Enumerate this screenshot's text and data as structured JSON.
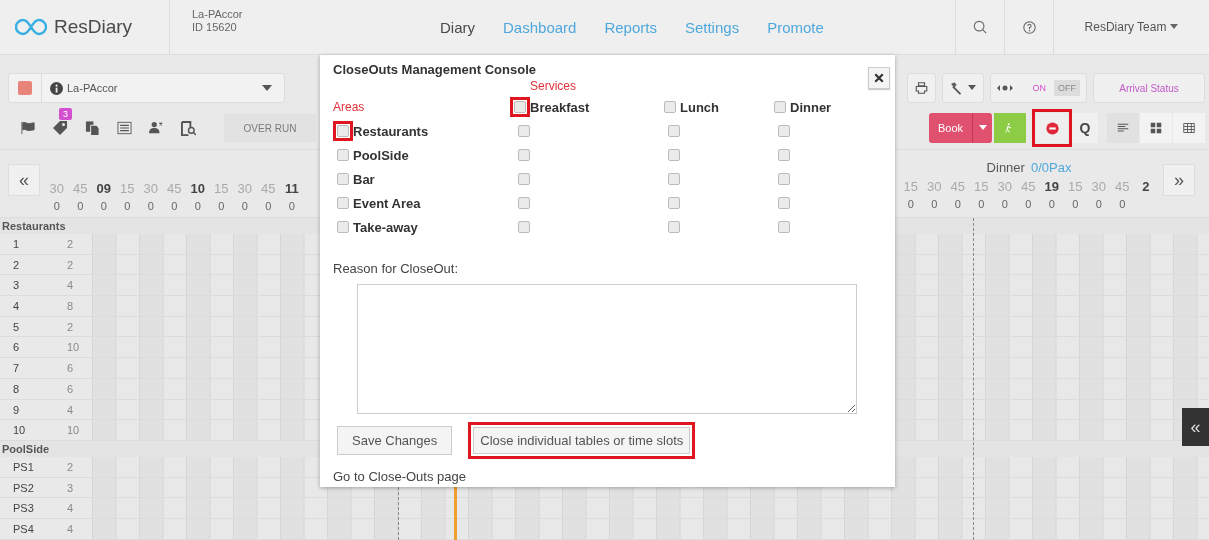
{
  "header": {
    "logo": "ResDiary",
    "venue": {
      "name": "La-PAccor",
      "id": "ID 15620"
    },
    "nav": [
      {
        "label": "Diary",
        "selected": true
      },
      {
        "label": "Dashboard",
        "selected": false
      },
      {
        "label": "Reports",
        "selected": false
      },
      {
        "label": "Settings",
        "selected": false
      },
      {
        "label": "Promote",
        "selected": false
      }
    ],
    "user": "ResDiary Team"
  },
  "toolbar": {
    "venue_select": "La-PAccor",
    "tag_badge": "3",
    "over_run": "OVER RUN",
    "toggle": [
      {
        "label": "ON",
        "selected": false
      },
      {
        "label": "OFF",
        "selected": true
      }
    ],
    "arrival_status": "Arrival Status",
    "book": "Book",
    "block_highlighted": true,
    "queue": "Q",
    "views": [
      {
        "kind": "list",
        "selected": true
      },
      {
        "kind": "tiles",
        "selected": false
      },
      {
        "kind": "table",
        "selected": false
      }
    ]
  },
  "timeline": {
    "prev": "«",
    "next": "»",
    "left_ticks": [
      {
        "label": "30",
        "hour": false
      },
      {
        "label": "45",
        "hour": false
      },
      {
        "label": "09",
        "hour": true
      },
      {
        "label": "15",
        "hour": false
      },
      {
        "label": "30",
        "hour": false
      },
      {
        "label": "45",
        "hour": false
      },
      {
        "label": "10",
        "hour": true
      },
      {
        "label": "15",
        "hour": false
      },
      {
        "label": "30",
        "hour": false
      },
      {
        "label": "45",
        "hour": false
      },
      {
        "label": "11",
        "hour": true
      }
    ],
    "left_counts": [
      "0",
      "0",
      "0",
      "0",
      "0",
      "0",
      "0",
      "0",
      "0",
      "0",
      "0"
    ],
    "service": "Dinner",
    "pax": "0/0Pax",
    "right_ticks": [
      {
        "label": "15",
        "hour": false
      },
      {
        "label": "30",
        "hour": false
      },
      {
        "label": "45",
        "hour": false
      },
      {
        "label": "15",
        "hour": false
      },
      {
        "label": "30",
        "hour": false
      },
      {
        "label": "45",
        "hour": false
      },
      {
        "label": "19",
        "hour": true
      },
      {
        "label": "15",
        "hour": false
      },
      {
        "label": "30",
        "hour": false
      },
      {
        "label": "45",
        "hour": false
      },
      {
        "label": "2",
        "hour": true
      }
    ],
    "right_counts": [
      "0",
      "0",
      "0",
      "0",
      "0",
      "0",
      "0",
      "0",
      "0",
      "0"
    ]
  },
  "sections": [
    {
      "name": "Restaurants",
      "tables": [
        {
          "name": "1",
          "covers": "2"
        },
        {
          "name": "2",
          "covers": "2"
        },
        {
          "name": "3",
          "covers": "4"
        },
        {
          "name": "4",
          "covers": "8"
        },
        {
          "name": "5",
          "covers": "2"
        },
        {
          "name": "6",
          "covers": "10"
        },
        {
          "name": "7",
          "covers": "6"
        },
        {
          "name": "8",
          "covers": "6"
        },
        {
          "name": "9",
          "covers": "4"
        },
        {
          "name": "10",
          "covers": "10"
        }
      ]
    },
    {
      "name": "PoolSide",
      "tables": [
        {
          "name": "PS1",
          "covers": "2"
        },
        {
          "name": "PS2",
          "covers": "3"
        },
        {
          "name": "PS3",
          "covers": "4"
        },
        {
          "name": "PS4",
          "covers": "4"
        }
      ]
    }
  ],
  "side_tab": "«",
  "modal": {
    "title": "CloseOuts Management Console",
    "services_label": "Services",
    "areas_label": "Areas",
    "services": [
      {
        "label": "Breakfast",
        "checked": false,
        "highlighted": true
      },
      {
        "label": "Lunch",
        "checked": false,
        "highlighted": false
      },
      {
        "label": "Dinner",
        "checked": false,
        "highlighted": false
      }
    ],
    "areas": [
      {
        "label": "Restaurants",
        "checked": false,
        "highlighted": true,
        "cells": [
          {
            "checked": false
          },
          {
            "checked": false
          },
          {
            "checked": false
          }
        ]
      },
      {
        "label": "PoolSide",
        "checked": false,
        "highlighted": false,
        "cells": [
          {
            "checked": false
          },
          {
            "checked": false
          },
          {
            "checked": false
          }
        ]
      },
      {
        "label": "Bar",
        "checked": false,
        "highlighted": false,
        "cells": [
          {
            "checked": false
          },
          {
            "checked": false
          },
          {
            "checked": false
          }
        ]
      },
      {
        "label": "Event Area",
        "checked": false,
        "highlighted": false,
        "cells": [
          {
            "checked": false
          },
          {
            "checked": false
          },
          {
            "checked": false
          }
        ]
      },
      {
        "label": "Take-away",
        "checked": false,
        "highlighted": false,
        "cells": [
          {
            "checked": false
          },
          {
            "checked": false
          },
          {
            "checked": false
          }
        ]
      }
    ],
    "reason_label": "Reason for CloseOut:",
    "buttons": [
      {
        "label": "Save Changes",
        "highlighted": false
      },
      {
        "label": "Close individual tables or time slots",
        "highlighted": true
      }
    ],
    "link": "Go to Close-Outs page"
  }
}
